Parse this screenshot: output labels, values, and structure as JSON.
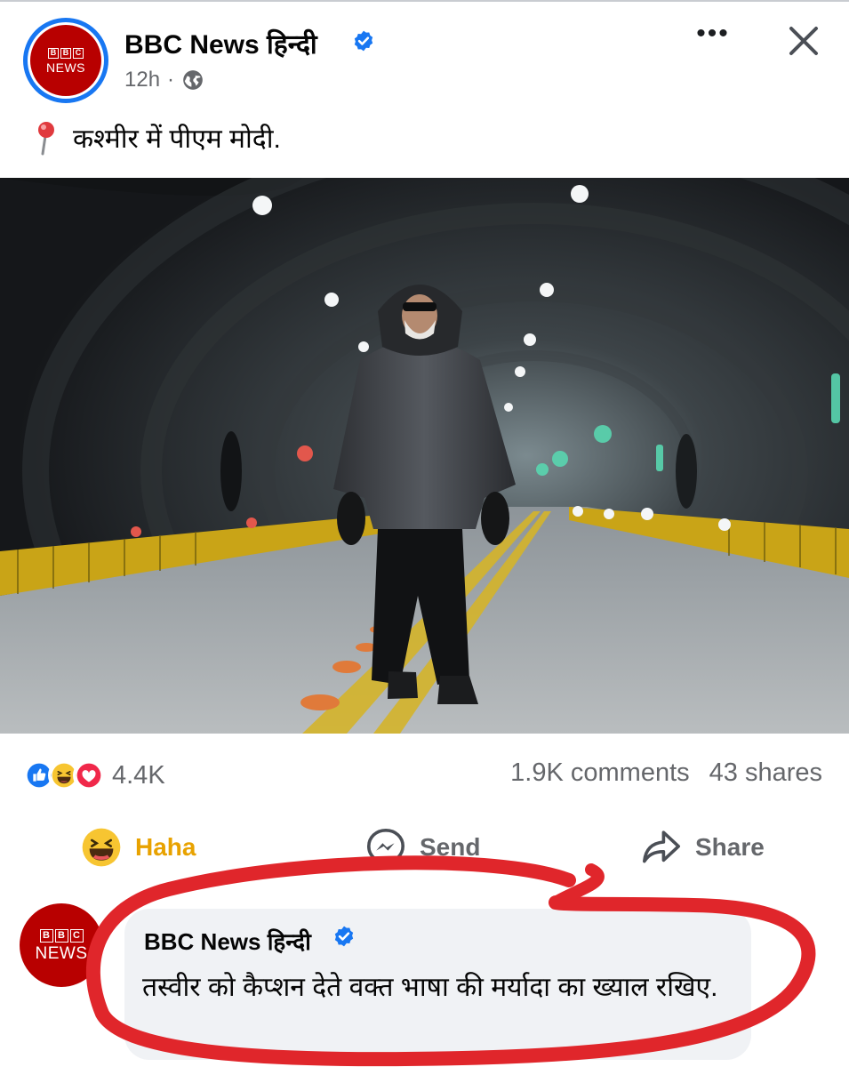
{
  "post": {
    "page_name": "BBC News हिन्दी",
    "time": "12h",
    "separator": "·",
    "caption": "कश्मीर में पीएम मोदी.",
    "avatar_blocks": [
      "B",
      "B",
      "C"
    ],
    "avatar_word": "NEWS"
  },
  "engagement": {
    "reaction_count": "4.4K",
    "comments": "1.9K comments",
    "shares": "43 shares",
    "reactions": [
      "like",
      "haha",
      "love"
    ]
  },
  "actions": {
    "haha_label": "Haha",
    "send_label": "Send",
    "share_label": "Share"
  },
  "comment": {
    "author": "BBC News हिन्दी",
    "text": "तस्वीर को कैप्शन देते वक्त भाषा की मर्यादा का ख्याल रखिए.",
    "avatar_blocks": [
      "B",
      "B",
      "C"
    ],
    "avatar_word": "NEWS"
  },
  "colors": {
    "facebook_blue": "#1877f2",
    "bbc_red": "#b80000",
    "muted_text": "#65676b",
    "haha_yellow": "#e8a200",
    "annotation_red": "#e0262b",
    "bubble_bg": "#f0f2f5"
  },
  "icons": {
    "verified": "verified-badge-icon",
    "globe": "globe-icon",
    "more": "more-options-icon",
    "close": "close-icon",
    "pin": "location-pin-icon",
    "send": "messenger-icon",
    "share": "share-arrow-icon"
  }
}
